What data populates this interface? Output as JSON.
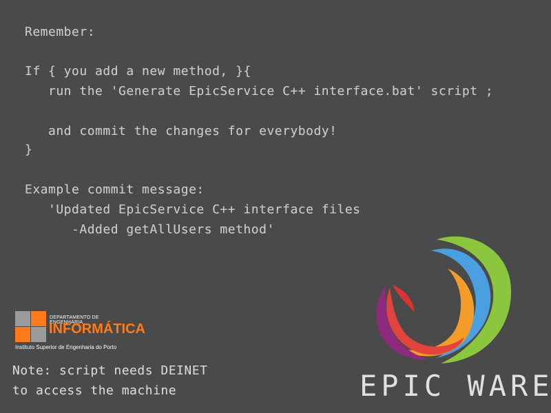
{
  "message": {
    "lines": [
      "Remember:",
      "",
      "If { you add a new method, }{",
      "   run the 'Generate EpicService C++ interface.bat' script ;",
      "",
      "   and commit the changes for everybody!",
      "}",
      "",
      "Example commit message:",
      "   'Updated EpicService C++ interface files",
      "      -Added getAllUsers method'"
    ]
  },
  "dei_logo": {
    "top_line": "DEPARTAMENTO DE ENGENHARIA",
    "main": "INFORMÁTICA",
    "institute": "Instituto Superior de Engenharia do Porto"
  },
  "note": {
    "line1": "Note: script needs DEINET",
    "line2": "to access the machine"
  },
  "brand": {
    "wordmark": "EPIC WARE"
  }
}
